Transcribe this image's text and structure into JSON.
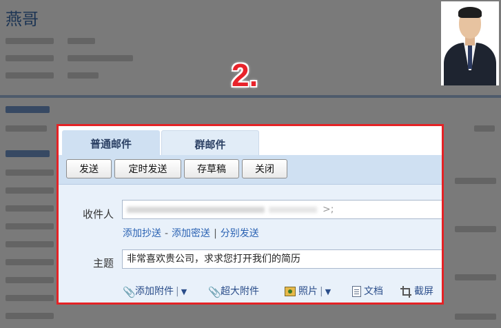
{
  "background": {
    "name": "燕哥"
  },
  "step_number": "2.",
  "mail": {
    "tabs": [
      {
        "label": "普通邮件"
      },
      {
        "label": "群邮件"
      }
    ],
    "toolbar": {
      "send": "发送",
      "timed_send": "定时发送",
      "save_draft": "存草稿",
      "close": "关闭"
    },
    "to_label": "收件人",
    "to_value_tail": ">;",
    "cc_links": {
      "add_cc": "添加抄送",
      "dash": "-",
      "add_bcc": "添加密送",
      "bar": "|",
      "separate_send": "分别发送"
    },
    "subject_label": "主题",
    "subject_value": "非常喜欢贵公司，求求您打开我们的简历",
    "attachments": {
      "add_attachment": "添加附件",
      "large_attachment": "超大附件",
      "photo": "照片",
      "document": "文档",
      "screenshot": "截屏"
    }
  },
  "colors": {
    "highlight_border": "#e52225",
    "step_number": "#e8232b",
    "toolbar_bg": "#cfe0f2",
    "form_bg": "#e9f1fa",
    "link": "#2a62b3"
  }
}
